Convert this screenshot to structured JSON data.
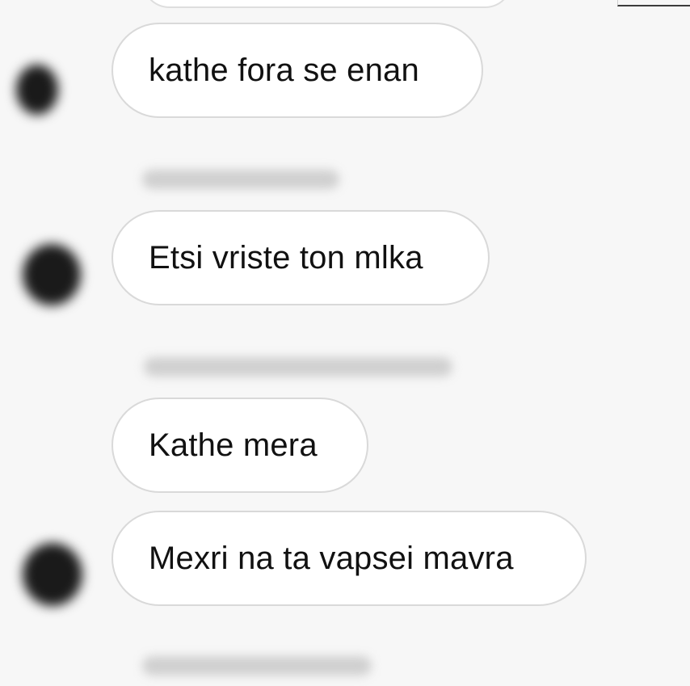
{
  "messages": [
    {
      "text": "kathe fora se enan"
    },
    {
      "text": "Etsi vriste ton mlka"
    },
    {
      "text": "Kathe mera"
    },
    {
      "text": "Mexri na ta vapsei mavra"
    }
  ]
}
